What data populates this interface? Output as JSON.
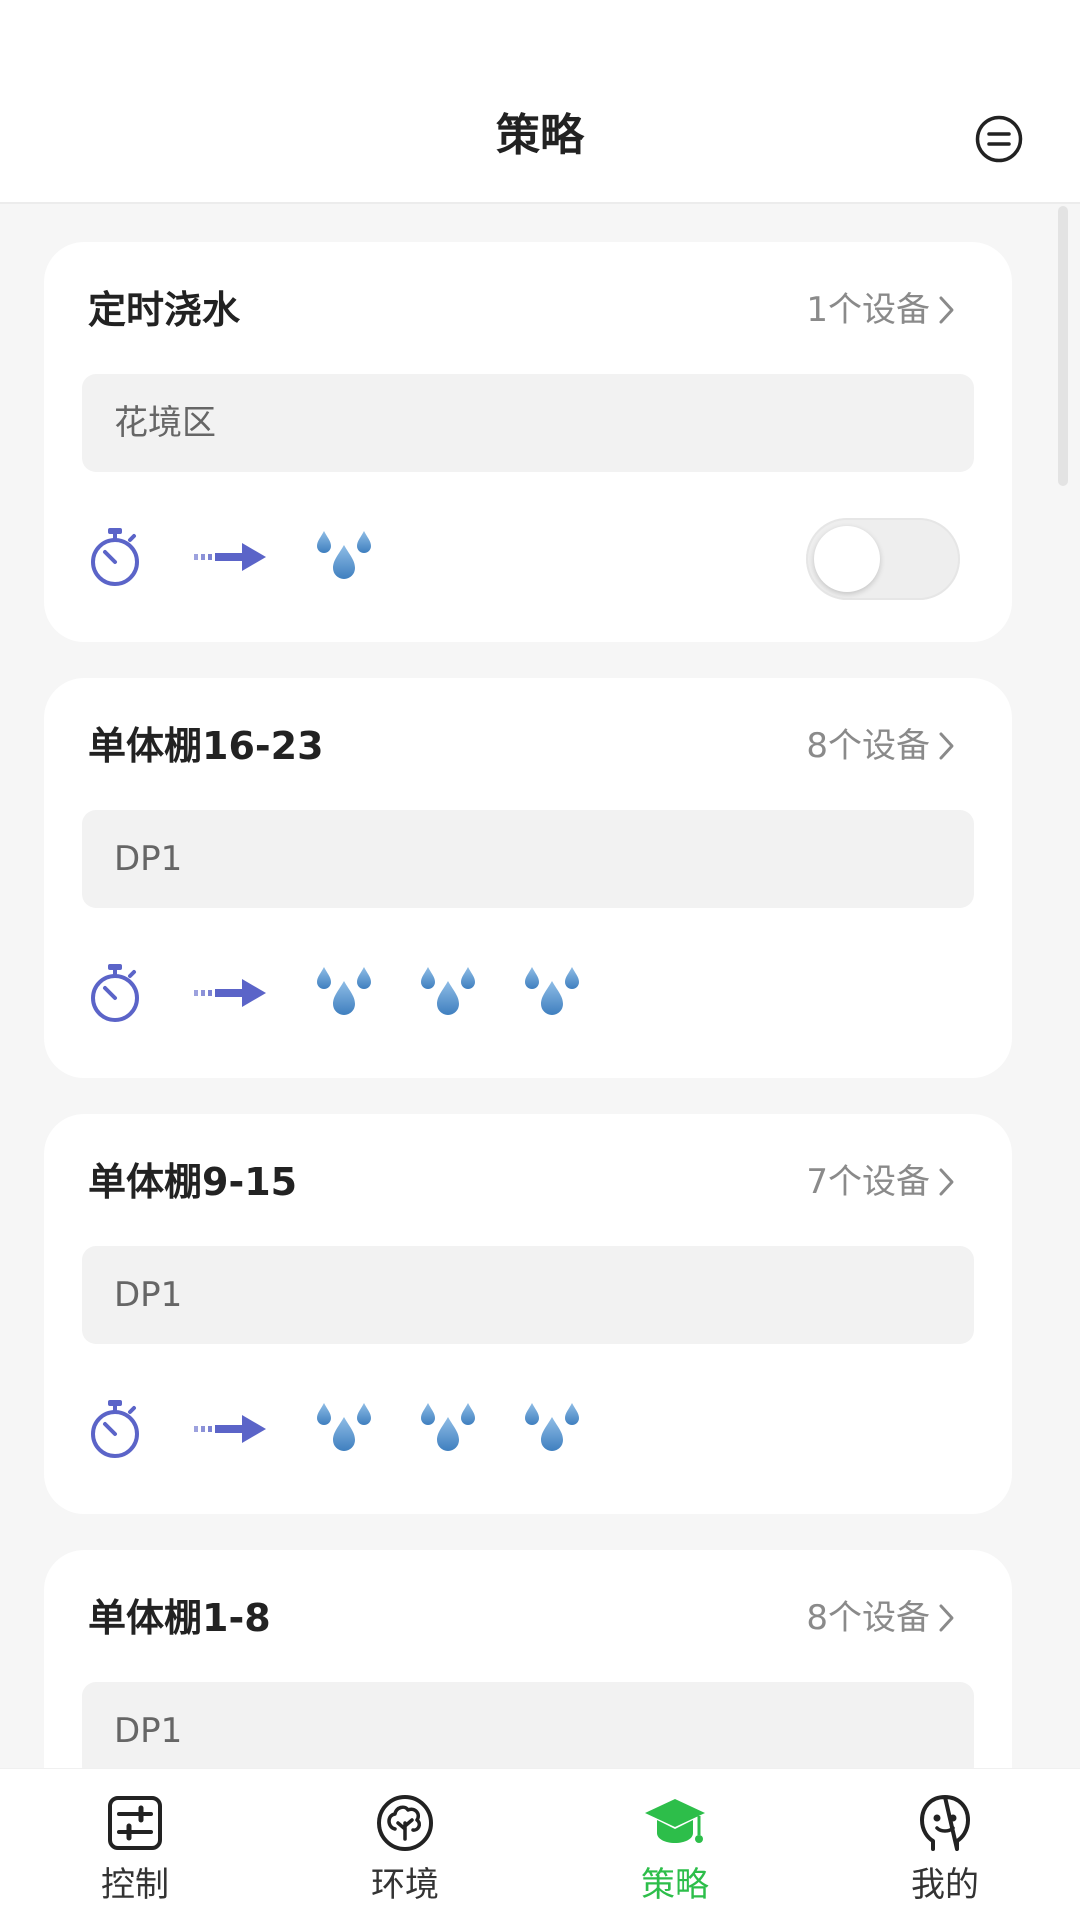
{
  "header": {
    "title": "策略"
  },
  "cards": [
    {
      "title": "定时浇水",
      "count": "1个设备",
      "zone": "花境区",
      "drops": 1,
      "has_toggle": true
    },
    {
      "title": "单体棚16-23",
      "count": "8个设备",
      "zone": "DP1",
      "drops": 3,
      "has_toggle": false
    },
    {
      "title": "单体棚9-15",
      "count": "7个设备",
      "zone": "DP1",
      "drops": 3,
      "has_toggle": false
    },
    {
      "title": "单体棚1-8",
      "count": "8个设备",
      "zone": "DP1",
      "drops": 0,
      "has_toggle": false
    }
  ],
  "nav": [
    {
      "label": "控制",
      "icon": "sliders-icon",
      "active": false
    },
    {
      "label": "环境",
      "icon": "tree-icon",
      "active": false
    },
    {
      "label": "策略",
      "icon": "graduation-cap-icon",
      "active": true
    },
    {
      "label": "我的",
      "icon": "smiley-face-icon",
      "active": false
    }
  ],
  "colors": {
    "accent_green": "#2dbe4a",
    "timer_blue": "#5b64c8",
    "drop_blue": "#4b8cc8",
    "text_gray": "#8a8a8a"
  }
}
